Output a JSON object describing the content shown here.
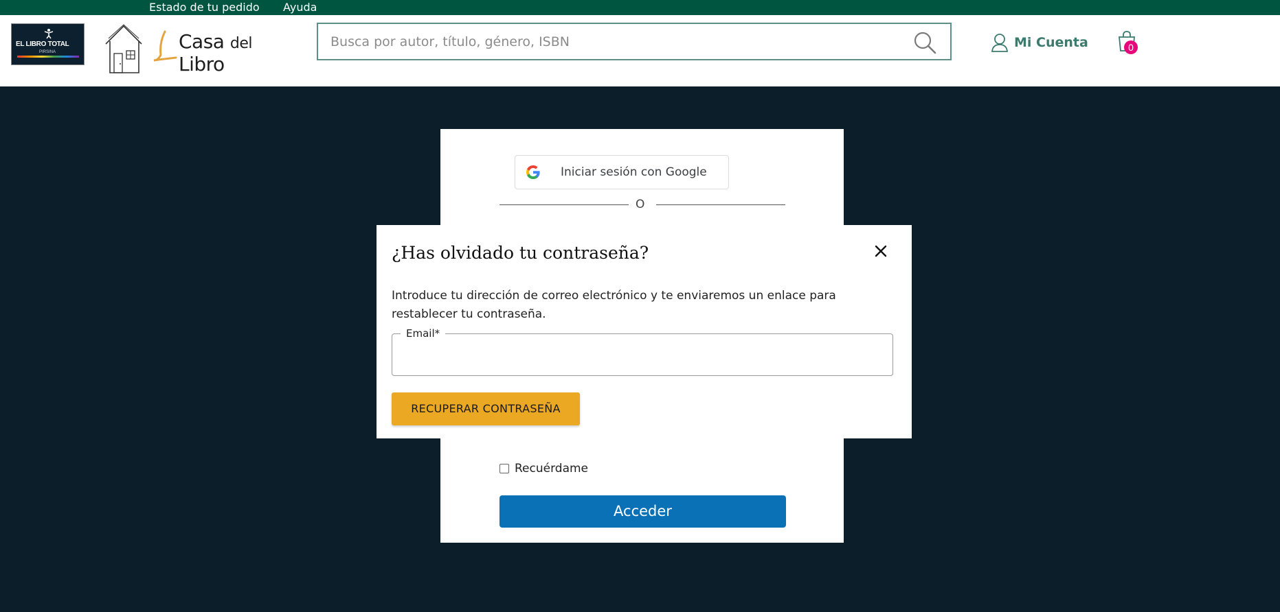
{
  "topbar": {
    "order_status": "Estado de tu pedido",
    "help": "Ayuda"
  },
  "header": {
    "logo_libro_total": "EL LIBRO TOTAL",
    "logo_libro_total_sub": "PIRSINA",
    "logo_casa_del_libro": {
      "casa": "Casa",
      "del": "del",
      "libro": "Libro"
    },
    "search_placeholder": "Busca por autor, título, género, ISBN",
    "account_label": "Mi Cuenta",
    "cart_count": "0"
  },
  "login": {
    "google_button": "Iniciar sesión con Google",
    "divider_text": "O",
    "remember_me": "Recuérdame",
    "submit": "Acceder"
  },
  "modal": {
    "title": "¿Has olvidado tu contraseña?",
    "description": "Introduce tu dirección de correo electrónico y te enviaremos un enlace para restablecer tu contraseña.",
    "email_label": "Email*",
    "email_value": "",
    "submit": "RECUPERAR CONTRASEÑA"
  },
  "colors": {
    "topbar": "#005540",
    "backdrop": "#0d1e2b",
    "accent_teal": "#3c7a6e",
    "primary_blue": "#0a71b6",
    "recover_orange": "#eaa823",
    "cart_badge": "#e6097b"
  }
}
